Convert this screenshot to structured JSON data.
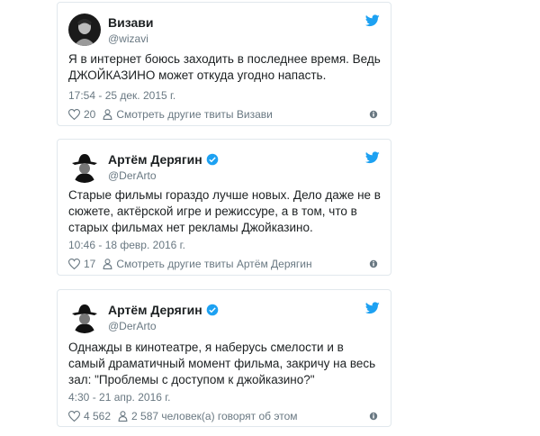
{
  "colors": {
    "twitter_blue": "#1da1f2",
    "verified_blue": "#1da1f2",
    "muted": "#697882",
    "border": "#e1e8ed"
  },
  "tweets": [
    {
      "name": "Визави",
      "handle": "@wizavi",
      "verified": false,
      "text": "Я в интернет боюсь заходить в последнее время. Ведь ДЖОЙКАЗИНО может откуда угодно напасть.",
      "date": "17:54 - 25 дек. 2015 г.",
      "likes": "20",
      "more": "Смотреть другие твиты Визави"
    },
    {
      "name": "Артём Дерягин",
      "handle": "@DerArto",
      "verified": true,
      "text": "Старые фильмы гораздо лучше новых. Дело даже не в сюжете, актёрской игре и режиссуре, а в том, что в старых фильмах нет рекламы Джойказино.",
      "date": "10:46 - 18 февр. 2016 г.",
      "likes": "17",
      "more": "Смотреть другие твиты Артём Дерягин"
    },
    {
      "name": "Артём Дерягин",
      "handle": "@DerArto",
      "verified": true,
      "text": "Однажды в кинотеатре, я наберусь смелости и в самый драматичный момент фильма, закричу на весь зал: \"Проблемы с доступом к джойказино?\"",
      "date": "4:30 - 21 апр. 2016 г.",
      "likes": "4 562",
      "more": "2 587 человек(а) говорят об этом"
    }
  ]
}
